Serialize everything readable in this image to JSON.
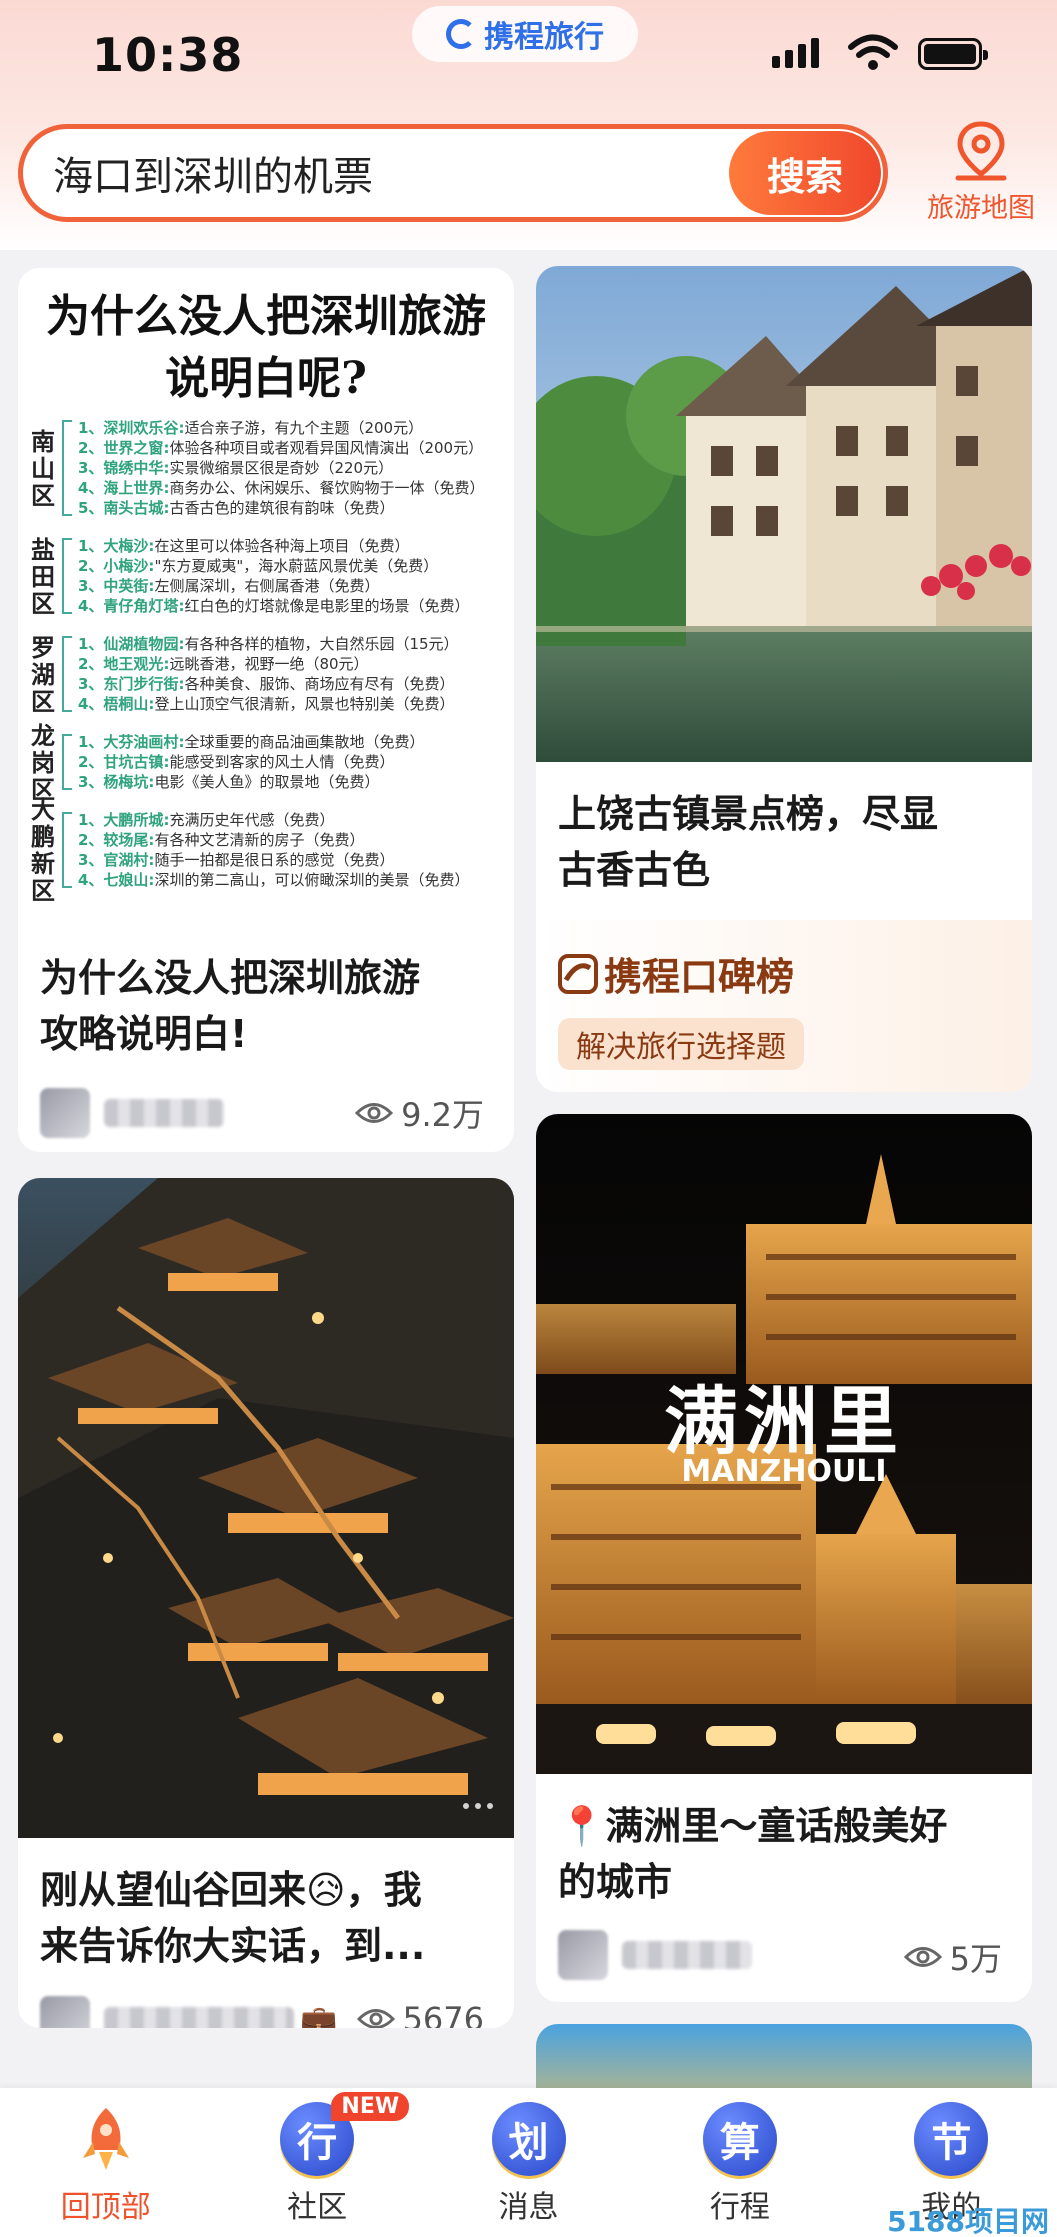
{
  "status_bar": {
    "time": "10:38",
    "brand": "携程旅行"
  },
  "search": {
    "value": "海口到深圳的机票",
    "button_label": "搜索",
    "map_label": "旅游地图"
  },
  "cards": {
    "shenzhen": {
      "infographic_title_line1": "为什么没人把深圳旅游",
      "infographic_title_line2": "说明白呢?",
      "districts": [
        {
          "name": "南山区",
          "spots": [
            {
              "label": "1、深圳欢乐谷:",
              "desc": "适合亲子游，有九个主题（200元）"
            },
            {
              "label": "2、世界之窗:",
              "desc": "体验各种项目或者观看异国风情演出（200元）"
            },
            {
              "label": "3、锦绣中华:",
              "desc": "实景微缩景区很是奇妙（220元）"
            },
            {
              "label": "4、海上世界:",
              "desc": "商务办公、休闲娱乐、餐饮购物于一体（免费）"
            },
            {
              "label": "5、南头古城:",
              "desc": "古香古色的建筑很有韵味（免费）"
            }
          ]
        },
        {
          "name": "盐田区",
          "spots": [
            {
              "label": "1、大梅沙:",
              "desc": "在这里可以体验各种海上项目（免费）"
            },
            {
              "label": "2、小梅沙:",
              "desc": "\"东方夏威夷\"，海水蔚蓝风景优美（免费）"
            },
            {
              "label": "3、中英街:",
              "desc": "左侧属深圳，右侧属香港（免费）"
            },
            {
              "label": "4、青仔角灯塔:",
              "desc": "红白色的灯塔就像是电影里的场景（免费）"
            }
          ]
        },
        {
          "name": "罗湖区",
          "spots": [
            {
              "label": "1、仙湖植物园:",
              "desc": "有各种各样的植物，大自然乐园（15元）"
            },
            {
              "label": "2、地王观光:",
              "desc": "远眺香港，视野一绝（80元）"
            },
            {
              "label": "3、东门步行街:",
              "desc": "各种美食、服饰、商场应有尽有（免费）"
            },
            {
              "label": "4、梧桐山:",
              "desc": "登上山顶空气很清新，风景也特别美（免费）"
            }
          ]
        },
        {
          "name": "龙岗区",
          "spots": [
            {
              "label": "1、大芬油画村:",
              "desc": "全球重要的商品油画集散地（免费）"
            },
            {
              "label": "2、甘坑古镇:",
              "desc": "能感受到客家的风土人情（免费）"
            },
            {
              "label": "3、杨梅坑:",
              "desc": "电影《美人鱼》的取景地（免费）"
            }
          ]
        },
        {
          "name": "大鹏新区",
          "spots": [
            {
              "label": "1、大鹏所城:",
              "desc": "充满历史年代感（免费）"
            },
            {
              "label": "2、较场尾:",
              "desc": "有各种文艺清新的房子（免费）"
            },
            {
              "label": "3、官湖村:",
              "desc": "随手一拍都是很日系的感觉（免费）"
            },
            {
              "label": "4、七娘山:",
              "desc": "深圳的第二高山，可以俯瞰深圳的美景（免费）"
            }
          ]
        }
      ],
      "title_line1": "为什么没人把深圳旅游",
      "title_line2": "攻略说明白!",
      "views": "9.2万"
    },
    "shangrao": {
      "title_line1": "上饶古镇景点榜，尽显",
      "title_line2": "古香古色",
      "koubei_brand": "携程口碑榜",
      "koubei_tag": "解决旅行选择题"
    },
    "wangxiangu": {
      "title_line1": "刚从望仙谷回来😥，我",
      "title_line2": "来告诉你大实话，到...",
      "views": "5676"
    },
    "manzhouli": {
      "overlay_title": "满洲里",
      "overlay_subtitle": "MANZHOULI",
      "title_line1": "📍满洲里～童话般美好",
      "title_line2": "的城市",
      "views": "5万"
    }
  },
  "bottom_nav": {
    "items": [
      {
        "label": "回顶部",
        "glyph": ""
      },
      {
        "label": "社区",
        "glyph": "行",
        "badge": "NEW"
      },
      {
        "label": "消息",
        "glyph": "划"
      },
      {
        "label": "行程",
        "glyph": "算"
      },
      {
        "label": "我的",
        "glyph": "节"
      }
    ]
  },
  "watermark": "5188项目网",
  "colors": {
    "accent": "#f0562e",
    "brand_blue": "#2f6fe8",
    "nav_active": "#f0532c"
  }
}
